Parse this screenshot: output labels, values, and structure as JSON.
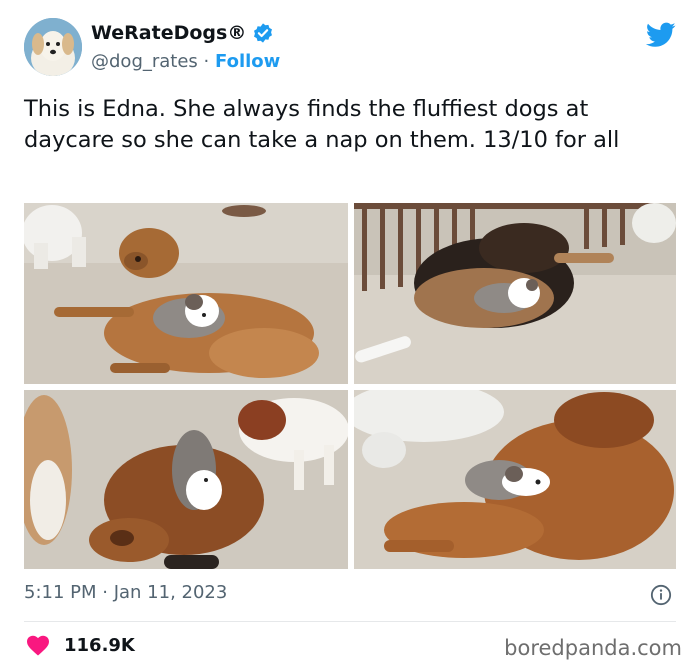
{
  "account": {
    "display_name": "WeRateDogs®",
    "handle": "@dog_rates",
    "separator": "·",
    "follow_label": "Follow"
  },
  "tweet": {
    "text": "This is Edna. She always finds the fluffiest dogs at daycare so she can take a nap on them. 13/10 for all",
    "time": "5:11 PM · Jan 11, 2023"
  },
  "engagement": {
    "likes": "116.9K"
  },
  "photos": [
    {
      "subject": "puppy napping on golden retriever"
    },
    {
      "subject": "puppy napping on shepherd mix"
    },
    {
      "subject": "puppy lying on red dog"
    },
    {
      "subject": "puppy napping on golden retriever"
    }
  ],
  "watermark": "boredpanda.com",
  "colors": {
    "accent": "#1d9bf0",
    "like_heart": "#f91880",
    "text_primary": "#0f1419",
    "text_secondary": "#536471"
  },
  "icons": {
    "verified": "verified-badge-icon",
    "brand": "twitter-bird-icon",
    "info": "info-icon",
    "like": "heart-icon"
  }
}
